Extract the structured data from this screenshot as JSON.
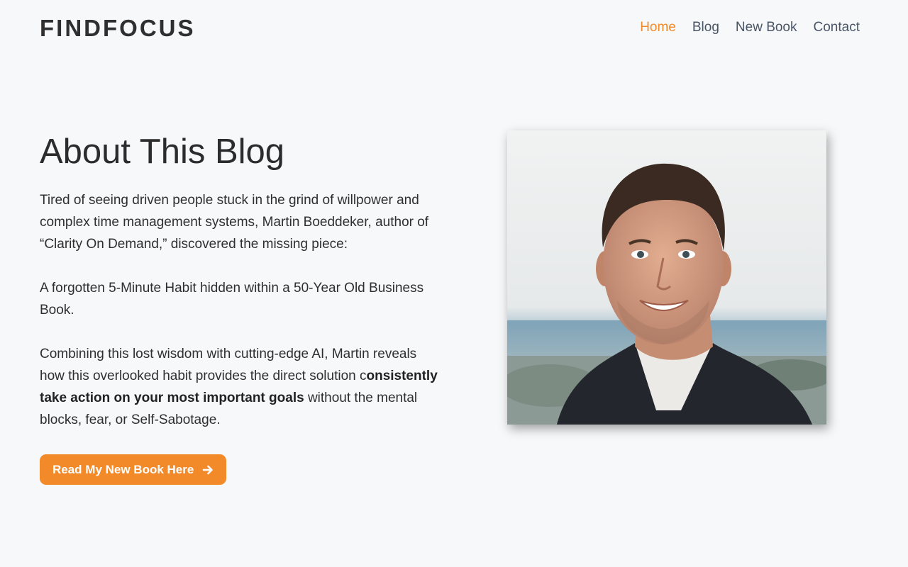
{
  "header": {
    "logo": "FINDFOCUS",
    "nav": [
      {
        "label": "Home",
        "active": true
      },
      {
        "label": "Blog",
        "active": false
      },
      {
        "label": "New Book",
        "active": false
      },
      {
        "label": "Contact",
        "active": false
      }
    ]
  },
  "main": {
    "title": "About This Blog",
    "para1": "Tired of seeing driven people stuck in the grind of willpower and complex time management systems, Martin Boeddeker, author of “Clarity On Demand,” discovered the missing piece:",
    "para2": "A forgotten 5-Minute Habit hidden within a 50-Year Old Business Book.",
    "para3": {
      "before": "Combining this lost wisdom with cutting-edge AI, Martin reveals how this overlooked habit provides the direct solution c",
      "bold": "onsistently take action on your most important goals",
      "after": " without the mental blocks, fear, or Self-Sabotage."
    },
    "cta": {
      "label": "Read My New Book Here",
      "icon": "arrow-right-icon"
    }
  },
  "photo": {
    "subject": "author-portrait"
  },
  "colors": {
    "accent": "#f28a2a",
    "background": "#f7f8fa",
    "text": "#2d2d2d",
    "nav": "#4a5566"
  }
}
